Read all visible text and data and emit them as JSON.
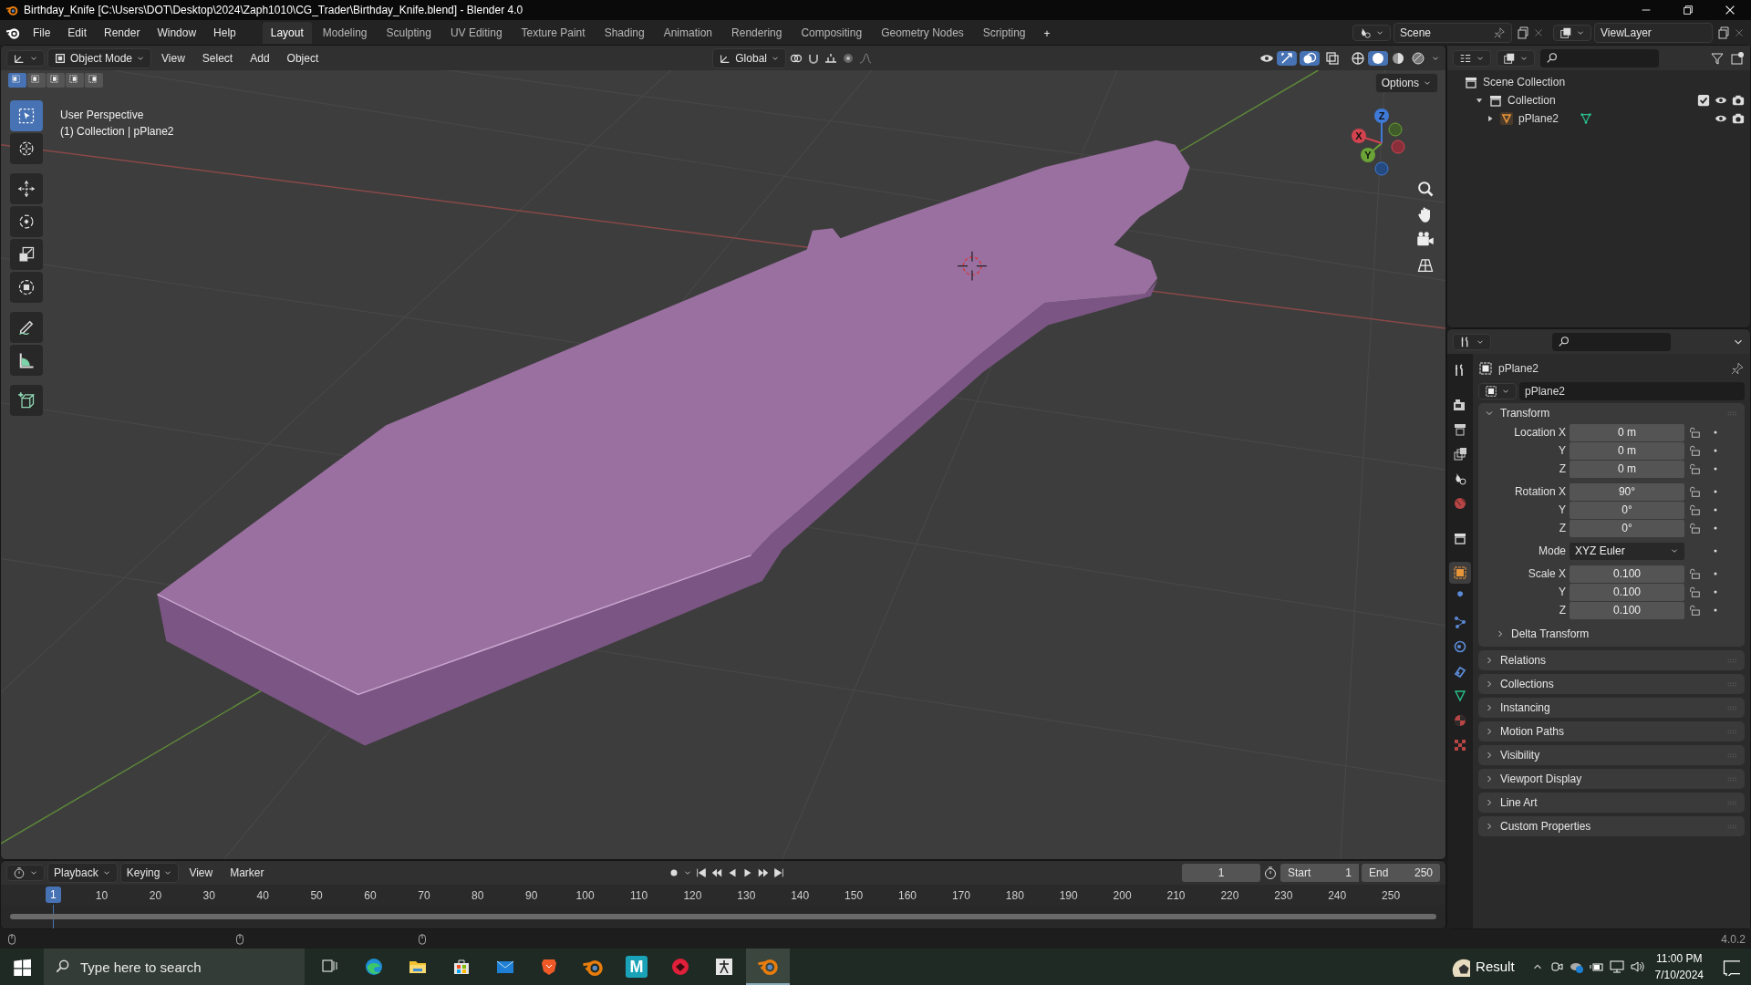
{
  "window": {
    "title": "Birthday_Knife [C:\\Users\\DOT\\Desktop\\2024\\Zaph1010\\CG_Trader\\Birthday_Knife.blend] - Blender 4.0"
  },
  "menu": [
    "File",
    "Edit",
    "Render",
    "Window",
    "Help"
  ],
  "workspaces": [
    {
      "label": "Layout",
      "selected": true
    },
    {
      "label": "Modeling",
      "selected": false
    },
    {
      "label": "Sculpting",
      "selected": false
    },
    {
      "label": "UV Editing",
      "selected": false
    },
    {
      "label": "Texture Paint",
      "selected": false
    },
    {
      "label": "Shading",
      "selected": false
    },
    {
      "label": "Animation",
      "selected": false
    },
    {
      "label": "Rendering",
      "selected": false
    },
    {
      "label": "Compositing",
      "selected": false
    },
    {
      "label": "Geometry Nodes",
      "selected": false
    },
    {
      "label": "Scripting",
      "selected": false
    }
  ],
  "add_workspace": "+",
  "scene": {
    "scene_name": "Scene",
    "view_layer": "ViewLayer"
  },
  "viewport_header": {
    "mode": "Object Mode",
    "menus": [
      "View",
      "Select",
      "Add",
      "Object"
    ],
    "orientation": "Global",
    "gizmos_on": true,
    "overlays_on": true,
    "xray_on": false,
    "shading": [
      {
        "kind": "wireframe",
        "selected": false
      },
      {
        "kind": "solid",
        "selected": true
      },
      {
        "kind": "material",
        "selected": false
      },
      {
        "kind": "rendered",
        "selected": false
      }
    ],
    "options": "Options"
  },
  "select_modes": [
    {
      "selected": true
    },
    {
      "selected": false
    },
    {
      "selected": false
    },
    {
      "selected": false
    },
    {
      "selected": false
    }
  ],
  "tools": [
    {
      "kind": "select",
      "selected": true
    },
    {
      "kind": "cursor",
      "selected": false
    },
    {
      "kind": "move",
      "selected": false
    },
    {
      "kind": "rotate",
      "selected": false
    },
    {
      "kind": "scale",
      "selected": false
    },
    {
      "kind": "transform",
      "selected": false
    },
    {
      "kind": "annotate",
      "selected": false
    },
    {
      "kind": "measure",
      "selected": false
    },
    {
      "kind": "add-cube",
      "selected": false
    }
  ],
  "viewport": {
    "info": [
      "User Perspective",
      "(1) Collection | pPlane2"
    ],
    "gizmo_axes": [
      "Z",
      "Y",
      "X"
    ]
  },
  "outliner": {
    "items": [
      {
        "label": "Scene Collection",
        "kind": "scene",
        "children": [
          {
            "label": "Collection",
            "kind": "collection",
            "expanded": true,
            "checked": true,
            "children": [
              {
                "label": "pPlane2",
                "kind": "mesh-object",
                "expanded": false
              }
            ]
          }
        ]
      }
    ]
  },
  "properties": {
    "tabs": [
      {
        "kind": "tool",
        "selected": false
      },
      {
        "kind": "render",
        "selected": false
      },
      {
        "kind": "output",
        "selected": false
      },
      {
        "kind": "view-layer",
        "selected": false
      },
      {
        "kind": "scene",
        "selected": false
      },
      {
        "kind": "world",
        "selected": false
      },
      {
        "kind": "collection",
        "selected": false
      },
      {
        "kind": "object",
        "selected": true
      },
      {
        "kind": "modifiers",
        "selected": false
      },
      {
        "kind": "particles",
        "selected": false
      },
      {
        "kind": "physics",
        "selected": false
      },
      {
        "kind": "constraints",
        "selected": false
      },
      {
        "kind": "data",
        "selected": false
      },
      {
        "kind": "material",
        "selected": false
      },
      {
        "kind": "texture",
        "selected": false
      }
    ],
    "object_name": "pPlane2",
    "data_name": "pPlane2",
    "transform": {
      "title": "Transform",
      "expanded": true,
      "groups": [
        {
          "rows": [
            {
              "label": "Location X",
              "value": "0 m",
              "kind": "number",
              "locked": false
            },
            {
              "label": "Y",
              "value": "0 m",
              "kind": "number",
              "locked": false
            },
            {
              "label": "Z",
              "value": "0 m",
              "kind": "number",
              "locked": false
            }
          ]
        },
        {
          "rows": [
            {
              "label": "Rotation X",
              "value": "90°",
              "kind": "number",
              "locked": false
            },
            {
              "label": "Y",
              "value": "0°",
              "kind": "number",
              "locked": false
            },
            {
              "label": "Z",
              "value": "0°",
              "kind": "number",
              "locked": false
            }
          ]
        },
        {
          "rows": [
            {
              "label": "Mode",
              "value": "XYZ Euler",
              "kind": "dropdown"
            }
          ]
        },
        {
          "rows": [
            {
              "label": "Scale X",
              "value": "0.100",
              "kind": "number",
              "locked": false
            },
            {
              "label": "Y",
              "value": "0.100",
              "kind": "number",
              "locked": false
            },
            {
              "label": "Z",
              "value": "0.100",
              "kind": "number",
              "locked": false
            }
          ]
        }
      ],
      "subpanel": {
        "title": "Delta Transform",
        "expanded": false
      }
    },
    "panels": [
      {
        "title": "Relations",
        "expanded": false
      },
      {
        "title": "Collections",
        "expanded": false
      },
      {
        "title": "Instancing",
        "expanded": false
      },
      {
        "title": "Motion Paths",
        "expanded": false
      },
      {
        "title": "Visibility",
        "expanded": false
      },
      {
        "title": "Viewport Display",
        "expanded": false
      },
      {
        "title": "Line Art",
        "expanded": false
      },
      {
        "title": "Custom Properties",
        "expanded": false
      }
    ]
  },
  "timeline": {
    "menus": [
      "Playback",
      "Keying",
      "View",
      "Marker"
    ],
    "current_frame": "1",
    "start_label": "Start",
    "start": "1",
    "end_label": "End",
    "end": "250",
    "ruler": [
      "1",
      "10",
      "20",
      "30",
      "40",
      "50",
      "60",
      "70",
      "80",
      "90",
      "100",
      "110",
      "120",
      "130",
      "140",
      "150",
      "160",
      "170",
      "180",
      "190",
      "200",
      "210",
      "220",
      "230",
      "240",
      "250"
    ]
  },
  "status_bar": {
    "version": "4.0.2"
  },
  "taskbar": {
    "search_placeholder": "Type here to search",
    "apps": [
      {
        "kind": "task-view",
        "selected": false
      },
      {
        "kind": "edge",
        "selected": false
      },
      {
        "kind": "explorer",
        "selected": false
      },
      {
        "kind": "store",
        "selected": false
      },
      {
        "kind": "mail",
        "selected": false
      },
      {
        "kind": "brave",
        "selected": false
      },
      {
        "kind": "blender",
        "selected": false
      },
      {
        "kind": "letter-app",
        "label": "M",
        "selected": false
      },
      {
        "kind": "red-app",
        "selected": false
      },
      {
        "kind": "figure-app",
        "selected": false
      },
      {
        "kind": "blender",
        "selected": true
      }
    ],
    "weather": "Result",
    "time": "11:00 PM",
    "date": "7/10/2024"
  }
}
